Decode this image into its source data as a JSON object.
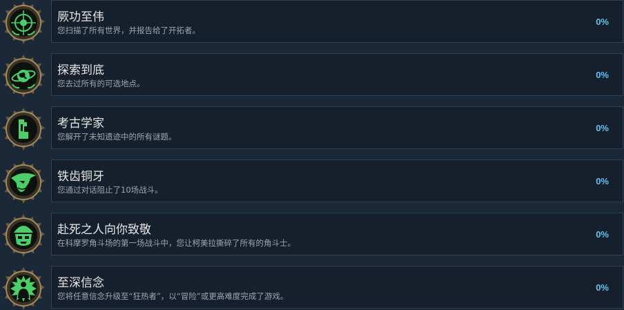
{
  "achievements": [
    {
      "title": "厥功至伟",
      "description": "您扫描了所有世界，并报告给了开拓者。",
      "percent": "0%",
      "icon": "compass-emblem-icon"
    },
    {
      "title": "探索到底",
      "description": "您去过所有的可选地点。",
      "percent": "0%",
      "icon": "magnifier-globe-icon"
    },
    {
      "title": "考古学家",
      "description": "您解开了未知遗迹中的所有谜题。",
      "percent": "0%",
      "icon": "ancient-glyph-icon"
    },
    {
      "title": "铁齿铜牙",
      "description": "您通过对话阻止了10场战斗。",
      "percent": "0%",
      "icon": "hooded-figure-icon"
    },
    {
      "title": "赴死之人向你致敬",
      "description": "在科摩罗角斗场的第一场战斗中，您让柯美拉撕碎了所有的角斗士。",
      "percent": "0%",
      "icon": "gladiator-helmet-icon"
    },
    {
      "title": "至深信念",
      "description": "您将任意信念升级至“狂热者”，以“冒险”或更高难度完成了游戏。",
      "percent": "0%",
      "icon": "radiant-figure-icon"
    }
  ],
  "colors": {
    "background": "#1b2838",
    "panel": "#16202d",
    "border": "#2e4256",
    "percent": "#66c0f4",
    "icon_green": "#4ccf6a"
  }
}
